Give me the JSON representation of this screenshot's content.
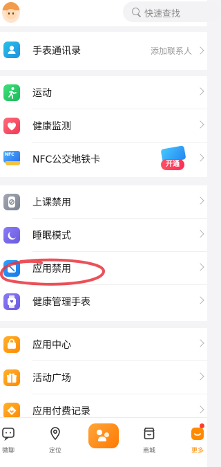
{
  "search": {
    "placeholder": "快速查找"
  },
  "sections": [
    {
      "items": [
        {
          "label": "手表通讯录",
          "sub": "添加联系人",
          "icon": "contacts-icon"
        }
      ]
    },
    {
      "items": [
        {
          "label": "运动",
          "icon": "run-icon"
        },
        {
          "label": "健康监测",
          "icon": "heart-icon"
        },
        {
          "label": "NFC公交地铁卡",
          "icon": "nfc-card-icon",
          "promo": "开通"
        }
      ]
    },
    {
      "items": [
        {
          "label": "上课禁用",
          "icon": "watch-disabled-icon"
        },
        {
          "label": "睡眠模式",
          "icon": "moon-icon"
        },
        {
          "label": "应用禁用",
          "icon": "app-disabled-icon"
        },
        {
          "label": "健康管理手表",
          "icon": "watch-icon"
        }
      ]
    },
    {
      "items": [
        {
          "label": "应用中心",
          "icon": "app-center-icon"
        },
        {
          "label": "活动广场",
          "icon": "gift-icon"
        },
        {
          "label": "应用付费记录",
          "icon": "payment-icon"
        }
      ]
    }
  ],
  "tabbar": [
    {
      "label": "微聊",
      "icon": "chat-icon"
    },
    {
      "label": "定位",
      "icon": "location-icon"
    },
    {
      "label": "",
      "icon": "family-icon"
    },
    {
      "label": "商城",
      "icon": "shop-icon"
    },
    {
      "label": "更多",
      "icon": "more-icon",
      "active": true
    }
  ],
  "colors": {
    "accent": "#ff8a00",
    "annotation": "#e8323c"
  }
}
